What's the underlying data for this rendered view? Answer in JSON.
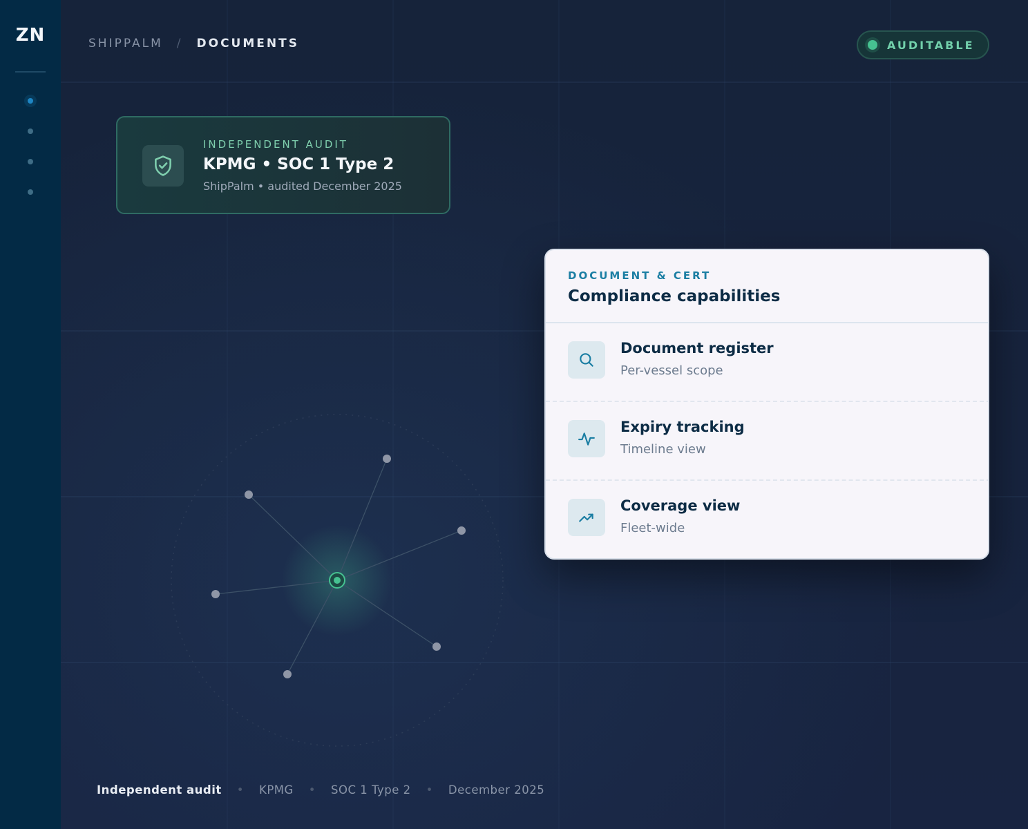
{
  "sidebar": {
    "logo": "ZN",
    "nav": [
      "nav-item-1",
      "nav-item-2",
      "nav-item-3",
      "nav-item-4"
    ]
  },
  "header": {
    "breadcrumb_root": "SHIPPALM",
    "breadcrumb_sep": "/",
    "breadcrumb_current": "DOCUMENTS",
    "status_badge": "AUDITABLE"
  },
  "audit_card": {
    "kicker": "INDEPENDENT AUDIT",
    "title": "KPMG • SOC 1 Type 2",
    "subtitle": "ShipPalm • audited December 2025",
    "icon": "shield-check-icon"
  },
  "capabilities": {
    "kicker": "DOCUMENT & CERT",
    "title": "Compliance capabilities",
    "items": [
      {
        "name": "Document register",
        "desc": "Per-vessel scope",
        "icon": "search-icon"
      },
      {
        "name": "Expiry tracking",
        "desc": "Timeline view",
        "icon": "activity-icon"
      },
      {
        "name": "Coverage view",
        "desc": "Fleet-wide",
        "icon": "trending-up-icon"
      }
    ]
  },
  "footer": {
    "items": [
      "Independent audit",
      "KPMG",
      "SOC 1 Type 2",
      "December 2025"
    ],
    "sep": "•"
  },
  "colors": {
    "sidebar": "#032a45",
    "background": "#17223a",
    "accent_green": "#46c291",
    "accent_blue": "#1b7ea3",
    "card_light": "#f7f5fa"
  }
}
